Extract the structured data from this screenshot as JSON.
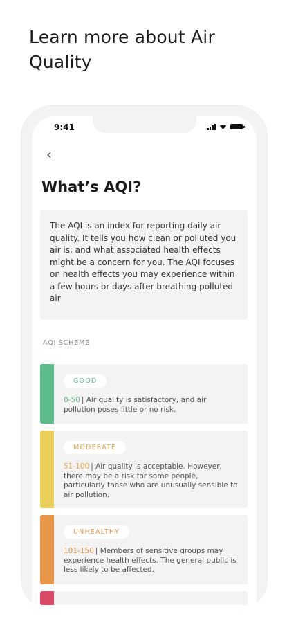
{
  "headline": "Learn more about Air Quality",
  "status_bar": {
    "time": "9:41"
  },
  "screen": {
    "title": "What’s AQI?",
    "intro": "The AQI is an index for reporting daily air quality. It tells you how clean or polluted you air is, and what associated health effects might be a concern for you. The AQI focuses on health effects you may experience within a few hours or days after breathing polluted air",
    "section_label": "AQI SCHEME",
    "scheme": [
      {
        "label": "GOOD",
        "range": "0-50",
        "description": "| Air quality is satisfactory, and air pollution poses little or no risk.",
        "color": "#5dbb8c",
        "text_color": "#5dbb8c"
      },
      {
        "label": "MODERATE",
        "range": "51-100",
        "description": "| Air quality is acceptable. However, there may be a risk for some people, particularly those who are unusually sensible to air pollution.",
        "color": "#e9cf5a",
        "text_color": "#e7a94e"
      },
      {
        "label": "UNHEALTHY",
        "range": "101-150",
        "description": "| Members of sensitive groups may experience health effects. The general public is less likely to be affected.",
        "color": "#e8964a",
        "text_color": "#e8964a"
      },
      {
        "color": "#d94a66"
      }
    ]
  },
  "icons": {
    "back": "chevron-left-icon"
  }
}
